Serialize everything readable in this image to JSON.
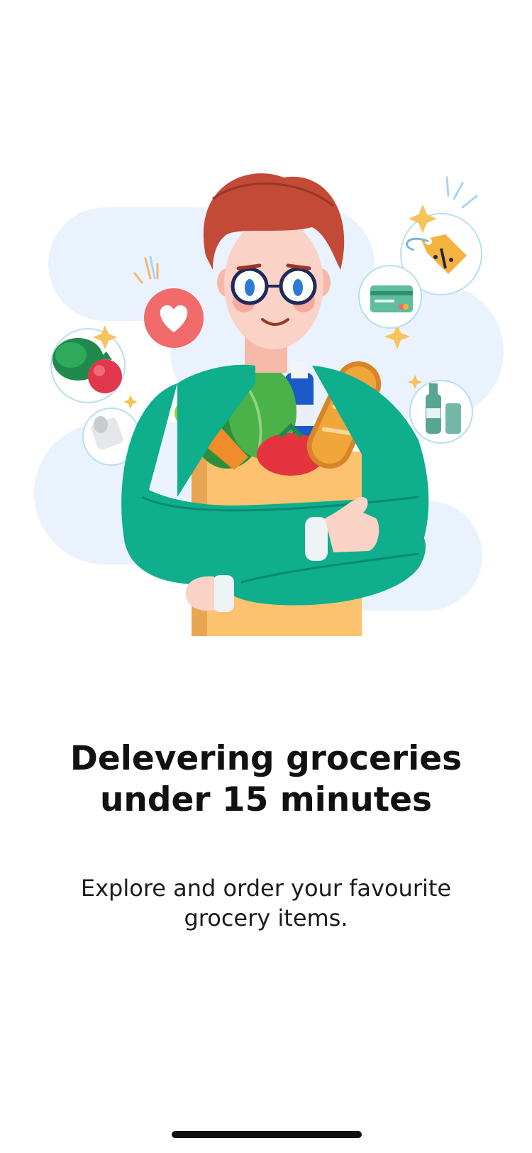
{
  "onboarding": {
    "title_line1": "Delevering groceries",
    "title_line2": "under 15 minutes",
    "subtitle_line1": "Explore and order your favourite",
    "subtitle_line2": "grocery items."
  },
  "illustration": {
    "icon": "man-with-grocery-bag-illustration"
  },
  "colors": {
    "background": "#ffffff",
    "sweater": "#0fae8d",
    "hair": "#c24a36",
    "bag": "#fcc26f",
    "blob": "#eaf2fd",
    "heart_bubble": "#f26b6b",
    "text": "#111111"
  }
}
